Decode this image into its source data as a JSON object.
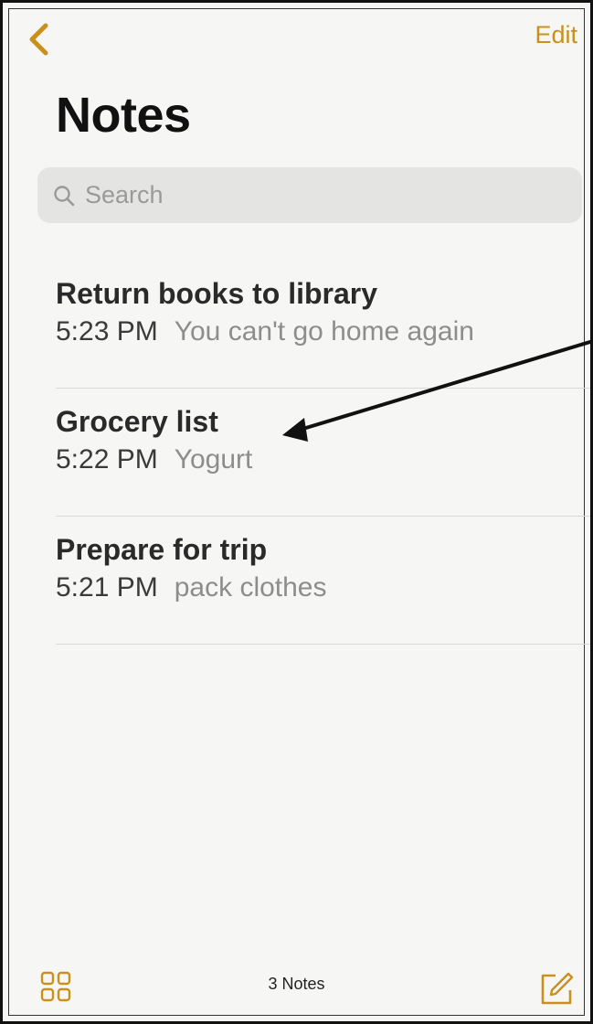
{
  "header": {
    "back_icon": "chevron-left-icon",
    "edit_label": "Edit",
    "title": "Notes"
  },
  "search": {
    "icon": "search-icon",
    "placeholder": "Search",
    "value": ""
  },
  "notes": [
    {
      "title": "Return books to library",
      "time": "5:23 PM",
      "preview": "You can't go home again"
    },
    {
      "title": "Grocery list",
      "time": "5:22 PM",
      "preview": "Yogurt"
    },
    {
      "title": "Prepare for trip",
      "time": "5:21 PM",
      "preview": "pack clothes"
    }
  ],
  "toolbar": {
    "gallery_icon": "gallery-grid-icon",
    "count_label": "3 Notes",
    "compose_icon": "compose-icon"
  },
  "colors": {
    "accent": "#c9911b",
    "background": "#f6f6f4",
    "search_background": "#e4e4e3"
  }
}
